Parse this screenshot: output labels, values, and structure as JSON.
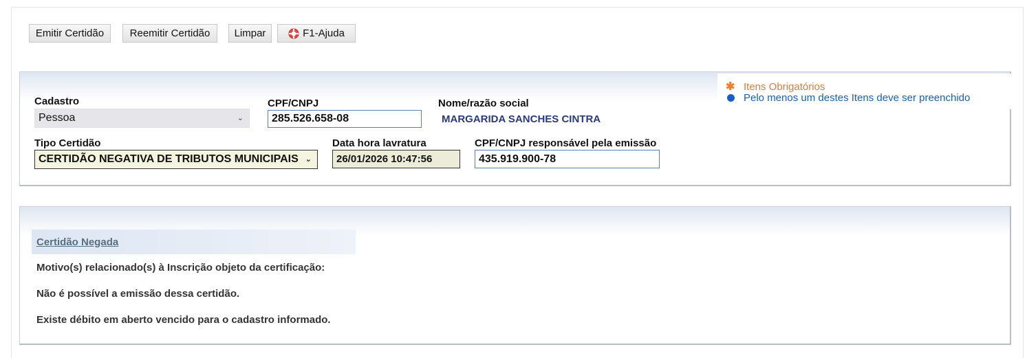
{
  "toolbar": {
    "emitir": "Emitir Certidão",
    "reemitir": "Reemitir Certidão",
    "limpar": "Limpar",
    "ajuda": "F1-Ajuda"
  },
  "legend": {
    "obrigatorios": "Itens Obrigatórios",
    "pelo_menos_um": "Pelo menos um destes Itens deve ser preenchido"
  },
  "form": {
    "cadastro_label": "Cadastro",
    "cadastro_value": "Pessoa",
    "cpf_label": "CPF/CNPJ",
    "cpf_value": "285.526.658-08",
    "nome_label": "Nome/razão social",
    "nome_value": "MARGARIDA SANCHES CINTRA",
    "tipo_label": "Tipo Certidão",
    "tipo_value": "CERTIDÃO NEGATIVA DE TRIBUTOS MUNICIPAIS",
    "data_label": "Data hora lavratura",
    "data_value": "26/01/2026 10:47:56",
    "resp_label": "CPF/CNPJ responsável pela emissão",
    "resp_value": "435.919.900-78"
  },
  "result": {
    "tab": "Certidão Negada",
    "motivo": "Motivo(s) relacionado(s) à Inscrição objeto da certificação:",
    "linha1": "Não é possível a emissão dessa certidão.",
    "linha2": "Existe débito em aberto vencido para o cadastro informado."
  },
  "colors": {
    "required_star": "#f08030",
    "required_text": "#e07b39",
    "one_of_dot": "#1a5fc8",
    "one_of_text": "#1a5fb0",
    "name_value": "#2b3a7a"
  }
}
